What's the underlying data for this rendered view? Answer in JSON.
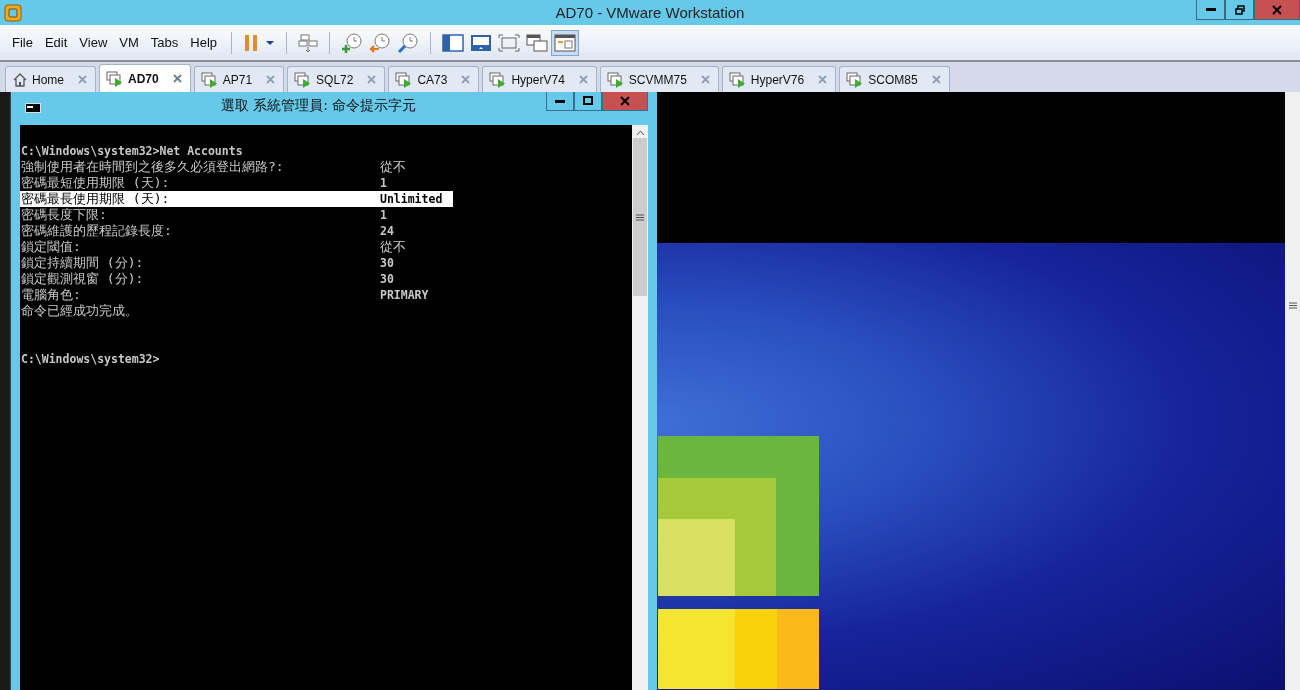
{
  "window": {
    "title": "AD70 - VMware Workstation"
  },
  "menu": [
    "File",
    "Edit",
    "View",
    "VM",
    "Tabs",
    "Help"
  ],
  "toolbar": {
    "console_view_selected": true
  },
  "tabs": [
    {
      "label": "Home",
      "kind": "home",
      "selected": false
    },
    {
      "label": "AD70",
      "kind": "vm",
      "selected": true
    },
    {
      "label": "AP71",
      "kind": "vm",
      "selected": false
    },
    {
      "label": "SQL72",
      "kind": "vm",
      "selected": false
    },
    {
      "label": "CA73",
      "kind": "vm",
      "selected": false
    },
    {
      "label": "HyperV74",
      "kind": "vm",
      "selected": false
    },
    {
      "label": "SCVMM75",
      "kind": "vm",
      "selected": false
    },
    {
      "label": "HyperV76",
      "kind": "vm",
      "selected": false
    },
    {
      "label": "SCOM85",
      "kind": "vm",
      "selected": false
    }
  ],
  "cmd_window": {
    "title": "選取 系統管理員: 命令提示字元",
    "lines": [
      {
        "kind": "command",
        "text": "C:\\Windows\\system32>Net Accounts",
        "selected": false
      },
      {
        "kind": "field",
        "label": "強制使用者在時間到之後多久必須登出網路?:",
        "value": "從不",
        "selected": false
      },
      {
        "kind": "field",
        "label": "密碼最短使用期限 (天):",
        "value": "1",
        "selected": false
      },
      {
        "kind": "field",
        "label": "密碼最長使用期限 (天):",
        "value": "Unlimited",
        "selected": true
      },
      {
        "kind": "field",
        "label": "密碼長度下限:",
        "value": "1",
        "selected": false
      },
      {
        "kind": "field",
        "label": "密碼維護的歷程記錄長度:",
        "value": "24",
        "selected": false
      },
      {
        "kind": "field",
        "label": "鎖定閾值:",
        "value": "從不",
        "selected": false
      },
      {
        "kind": "field",
        "label": "鎖定持續期間 (分):",
        "value": "30",
        "selected": false
      },
      {
        "kind": "field",
        "label": "鎖定觀測視窗 (分):",
        "value": "30",
        "selected": false
      },
      {
        "kind": "field",
        "label": "電腦角色:",
        "value": "PRIMARY",
        "selected": false
      },
      {
        "kind": "message",
        "text": "命令已經成功完成。",
        "selected": false
      },
      {
        "kind": "prompt",
        "text": "C:\\Windows\\system32>",
        "selected": false
      }
    ]
  }
}
